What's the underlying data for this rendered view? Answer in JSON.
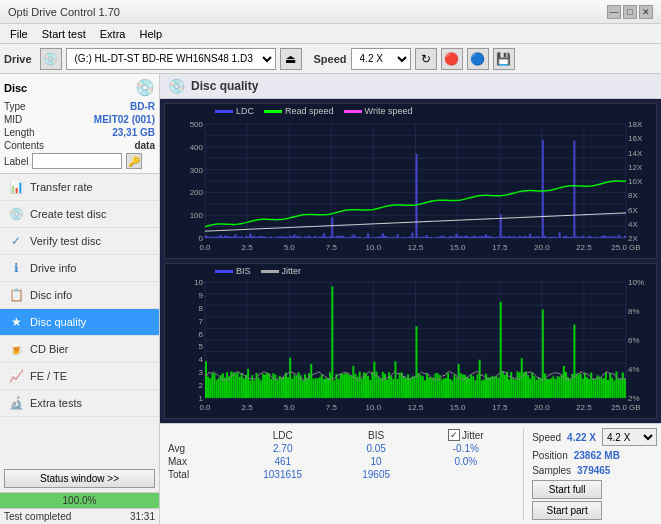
{
  "app": {
    "title": "Opti Drive Control 1.70",
    "title_bar_buttons": [
      "—",
      "□",
      "✕"
    ]
  },
  "menu": {
    "items": [
      "File",
      "Start test",
      "Extra",
      "Help"
    ]
  },
  "toolbar": {
    "drive_label": "Drive",
    "drive_value": "(G:) HL-DT-ST BD-RE  WH16NS48 1.D3",
    "speed_label": "Speed",
    "speed_value": "4.2 X"
  },
  "disc": {
    "title": "Disc",
    "type_label": "Type",
    "type_value": "BD-R",
    "mid_label": "MID",
    "mid_value": "MEIT02 (001)",
    "length_label": "Length",
    "length_value": "23,31 GB",
    "contents_label": "Contents",
    "contents_value": "data",
    "label_label": "Label",
    "label_value": ""
  },
  "nav": {
    "items": [
      {
        "id": "transfer-rate",
        "label": "Transfer rate",
        "icon": "📊"
      },
      {
        "id": "create-test-disc",
        "label": "Create test disc",
        "icon": "💿"
      },
      {
        "id": "verify-test-disc",
        "label": "Verify test disc",
        "icon": "✓"
      },
      {
        "id": "drive-info",
        "label": "Drive info",
        "icon": "ℹ"
      },
      {
        "id": "disc-info",
        "label": "Disc info",
        "icon": "📋"
      },
      {
        "id": "disc-quality",
        "label": "Disc quality",
        "icon": "★",
        "active": true
      },
      {
        "id": "cd-bier",
        "label": "CD Bier",
        "icon": "🍺"
      },
      {
        "id": "fe-te",
        "label": "FE / TE",
        "icon": "📈"
      },
      {
        "id": "extra-tests",
        "label": "Extra tests",
        "icon": "🔬"
      }
    ]
  },
  "content": {
    "title": "Disc quality",
    "chart1": {
      "title": "LDC chart",
      "legend": [
        {
          "label": "LDC",
          "color": "#4444ff"
        },
        {
          "label": "Read speed",
          "color": "#00ff00"
        },
        {
          "label": "Write speed",
          "color": "#ff00ff"
        }
      ],
      "y_max": 500,
      "y_labels_left": [
        "500",
        "400",
        "300",
        "200",
        "100",
        "0"
      ],
      "y_labels_right": [
        "18X",
        "16X",
        "14X",
        "12X",
        "10X",
        "8X",
        "6X",
        "4X",
        "2X"
      ],
      "x_labels": [
        "0.0",
        "2.5",
        "5.0",
        "7.5",
        "10.0",
        "12.5",
        "15.0",
        "17.5",
        "20.0",
        "22.5",
        "25.0 GB"
      ]
    },
    "chart2": {
      "title": "BIS chart",
      "legend": [
        {
          "label": "BIS",
          "color": "#4444ff"
        },
        {
          "label": "Jitter",
          "color": "#888888"
        }
      ],
      "y_max": 10,
      "y_labels_left": [
        "10",
        "9",
        "8",
        "7",
        "6",
        "5",
        "4",
        "3",
        "2",
        "1"
      ],
      "y_labels_right": [
        "10%",
        "8%",
        "6%",
        "4%",
        "2%"
      ],
      "x_labels": [
        "0.0",
        "2.5",
        "5.0",
        "7.5",
        "10.0",
        "12.5",
        "15.0",
        "17.5",
        "20.0",
        "22.5",
        "25.0 GB"
      ]
    }
  },
  "stats": {
    "columns": [
      "",
      "LDC",
      "BIS",
      "",
      "Jitter"
    ],
    "avg": {
      "label": "Avg",
      "ldc": "2.70",
      "bis": "0.05",
      "jitter": "-0.1%"
    },
    "max": {
      "label": "Max",
      "ldc": "461",
      "bis": "10",
      "jitter": "0.0%"
    },
    "total": {
      "label": "Total",
      "ldc": "1031615",
      "bis": "19605"
    },
    "jitter_checked": true,
    "speed_label": "Speed",
    "speed_value": "4.22 X",
    "position_label": "Position",
    "position_value": "23862 MB",
    "samples_label": "Samples",
    "samples_value": "379465",
    "speed_select": "4.2 X",
    "start_full_btn": "Start full",
    "start_part_btn": "Start part"
  },
  "status": {
    "progress": 100,
    "progress_text": "100.0%",
    "status_text": "Test completed",
    "time": "31:31",
    "status_window_btn": "Status window >>"
  },
  "colors": {
    "chart_bg": "#1a2040",
    "grid_color": "#2a3560",
    "ldc_color": "#4444dd",
    "read_speed_color": "#00ff00",
    "write_speed_color": "#ff44ff",
    "bis_color": "#4444dd",
    "jitter_color": "#aaaaaa",
    "accent_blue": "#3399ff",
    "sidebar_active": "#3399ff"
  }
}
